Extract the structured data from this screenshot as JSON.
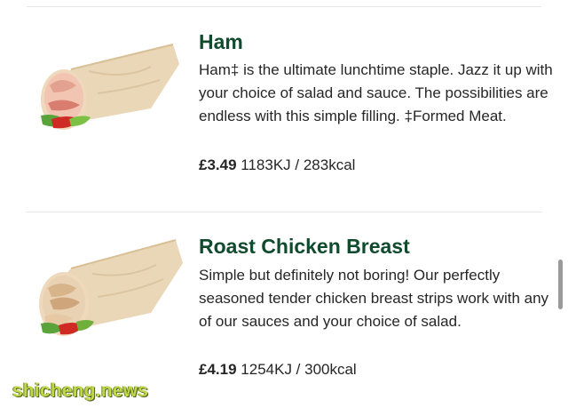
{
  "items": [
    {
      "name": "Ham",
      "description": "Ham‡ is the ultimate lunchtime staple. Jazz it up with your choice of salad and sauce. The possibilities are endless with this simple filling. ‡Formed Meat.",
      "price": "£3.49",
      "nutrition": "1183KJ / 283kcal",
      "image_icon": "ham-wrap-icon"
    },
    {
      "name": "Roast Chicken Breast",
      "description": "Simple but definitely not boring! Our perfectly seasoned tender chicken breast strips work with any of our sauces and your choice of salad.",
      "price": "£4.19",
      "nutrition": "1254KJ / 300kcal",
      "image_icon": "chicken-wrap-icon"
    }
  ],
  "watermark": "shicheng.news",
  "colors": {
    "title": "#114b2e",
    "text": "#262626",
    "divider": "#e6e6e6",
    "watermark": "#c1d74a"
  }
}
